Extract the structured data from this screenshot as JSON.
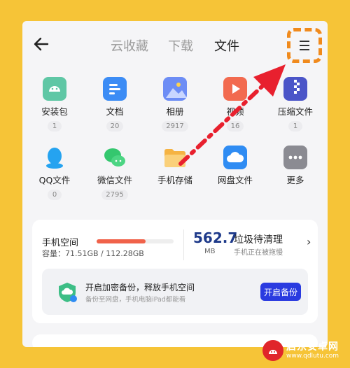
{
  "header": {
    "tabs": [
      {
        "label": "云收藏"
      },
      {
        "label": "下载"
      },
      {
        "label": "文件"
      }
    ]
  },
  "grid": [
    {
      "label": "安装包",
      "count": "1",
      "icon": "android-icon",
      "color": "#5FC7A5"
    },
    {
      "label": "文档",
      "count": "20",
      "icon": "document-icon",
      "color": "#3C8CF5"
    },
    {
      "label": "相册",
      "count": "2917",
      "icon": "photo-icon",
      "color": "#6D8DF5"
    },
    {
      "label": "视频",
      "count": "16",
      "icon": "video-play-icon",
      "color": "#F26A4F"
    },
    {
      "label": "压缩文件",
      "count": "1",
      "icon": "zip-icon",
      "color": "#4B55C8"
    },
    {
      "label": "QQ文件",
      "count": "0",
      "icon": "qq-icon",
      "color": "#25A3F0"
    },
    {
      "label": "微信文件",
      "count": "2795",
      "icon": "wechat-icon",
      "color": "#34C76E"
    },
    {
      "label": "手机存储",
      "icon": "folder-icon",
      "color": "#F5B343"
    },
    {
      "label": "网盘文件",
      "icon": "cloud-icon",
      "color": "#2F8CF3"
    },
    {
      "label": "更多",
      "icon": "more-icon",
      "color": "#8B8B92"
    }
  ],
  "storage": {
    "title": "手机空间",
    "used_fraction": 0.64,
    "capacity": "容量：71.51GB / 112.28GB",
    "junk_value": "562.7",
    "junk_unit": "MB",
    "junk_title": "垃圾待清理",
    "junk_sub": "手机正在被拖慢"
  },
  "backup": {
    "title": "开启加密备份，释放手机空间",
    "subtitle": "备份至网盘，手机电脑iPad都能看",
    "button": "开启备份"
  },
  "watermark": {
    "name": "启东安卓网",
    "url": "www.qdlutu.com"
  }
}
